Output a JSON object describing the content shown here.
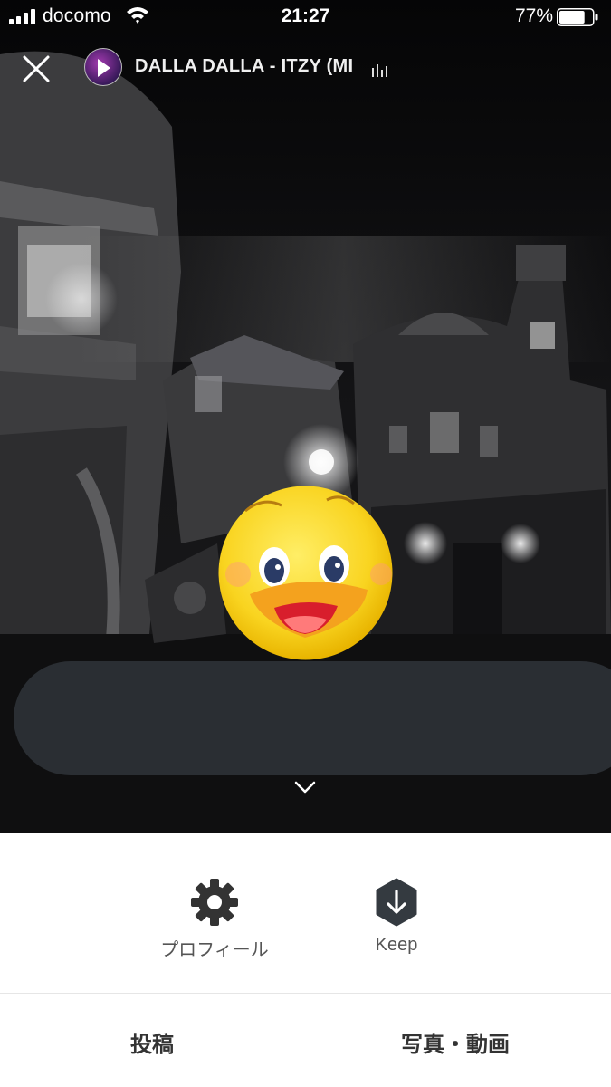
{
  "status_bar": {
    "carrier": "docomo",
    "time": "21:27",
    "battery_percent": "77%",
    "battery_level": 0.77,
    "icons": [
      "signal-icon",
      "wifi-icon",
      "battery-icon"
    ]
  },
  "story_header": {
    "close_icon": "close-icon",
    "music_title": "DALLA DALLA - ITZY (MI",
    "music_icon": "play-icon",
    "equalizer_icon": "equalizer-icon"
  },
  "story_canvas": {
    "sticker": "duck-face-sticker",
    "text_box_placeholder": "",
    "collapse_icon": "chevron-down-icon"
  },
  "action_panel": {
    "profile_label": "プロフィール",
    "profile_icon": "gear-icon",
    "keep_label": "Keep",
    "keep_icon": "download-hexagon-icon"
  },
  "bottom_tabs": {
    "post_label": "投稿",
    "photo_video_label": "写真・動画"
  },
  "colors": {
    "text_box": "#2a2e33",
    "icon_dark": "#333333",
    "scene_background": "#0b0b0c"
  }
}
